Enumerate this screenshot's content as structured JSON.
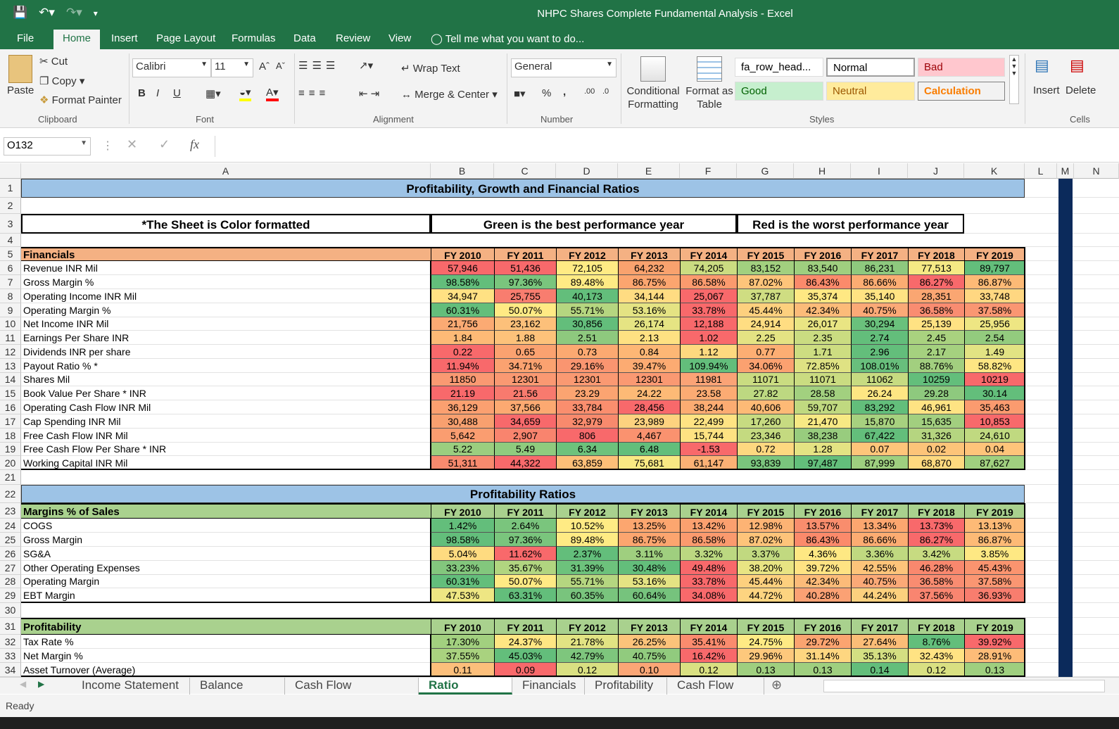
{
  "window": {
    "title": "NHPC Shares Complete Fundamental Analysis - Excel"
  },
  "ribbon_tabs": [
    "File",
    "Home",
    "Insert",
    "Page Layout",
    "Formulas",
    "Data",
    "Review",
    "View"
  ],
  "tell_me": "Tell me what you want to do...",
  "clipboard": {
    "paste": "Paste",
    "cut": "Cut",
    "copy": "Copy",
    "format_painter": "Format Painter",
    "label": "Clipboard"
  },
  "font": {
    "name": "Calibri",
    "size": "11",
    "label": "Font",
    "bold": "B",
    "italic": "I",
    "underline": "U"
  },
  "alignment": {
    "wrap": "Wrap Text",
    "merge": "Merge & Center",
    "label": "Alignment"
  },
  "number": {
    "format": "General",
    "label": "Number",
    "percent": "%",
    "comma": ","
  },
  "styles": {
    "cond": "Conditional Formatting",
    "table": "Format as Table",
    "label": "Styles",
    "cells": [
      {
        "t": "fa_row_head...",
        "bg": "#ffffff",
        "fg": "#000000"
      },
      {
        "t": "Normal",
        "bg": "#ffffff",
        "fg": "#000000"
      },
      {
        "t": "Bad",
        "bg": "#ffc7ce",
        "fg": "#9c0006"
      },
      {
        "t": "Good",
        "bg": "#c6efce",
        "fg": "#006100"
      },
      {
        "t": "Neutral",
        "bg": "#ffeb9c",
        "fg": "#9c5700"
      },
      {
        "t": "Calculation",
        "bg": "#f2f2f2",
        "fg": "#fa7d00"
      }
    ]
  },
  "cells_group": {
    "insert": "Insert",
    "delete": "Delete",
    "label": "Cells"
  },
  "namebox": "O132",
  "fx": "fx",
  "col_headers": [
    "A",
    "B",
    "C",
    "D",
    "E",
    "F",
    "G",
    "H",
    "I",
    "J",
    "K",
    "L",
    "M",
    "N"
  ],
  "title_row": "Profitability, Growth and Financial Ratios",
  "note_a": "*The Sheet is Color formatted",
  "note_green": "Green is the best performance year",
  "note_red": "Red is the worst performance year",
  "years": [
    "FY 2010",
    "FY 2011",
    "FY 2012",
    "FY 2013",
    "FY 2014",
    "FY 2015",
    "FY 2016",
    "FY 2017",
    "FY 2018",
    "FY 2019"
  ],
  "financials": {
    "header": "Financials",
    "rows": [
      {
        "label": "Revenue INR Mil",
        "v": [
          "57,946",
          "51,436",
          "72,105",
          "64,232",
          "74,205",
          "83,152",
          "83,540",
          "86,231",
          "77,513",
          "89,797"
        ],
        "c": [
          "#f8696b",
          "#f8696b",
          "#ffeb84",
          "#f9a26e",
          "#cbdc81",
          "#a2d07f",
          "#9fcf7f",
          "#8ec97e",
          "#f5e984",
          "#63be7b"
        ]
      },
      {
        "label": "Gross Margin %",
        "v": [
          "98.58%",
          "97.36%",
          "89.48%",
          "86.75%",
          "86.58%",
          "87.02%",
          "86.43%",
          "86.66%",
          "86.27%",
          "86.87%"
        ],
        "c": [
          "#63be7b",
          "#7ac57d",
          "#ffeb84",
          "#fca56f",
          "#fb9a6e",
          "#fec47a",
          "#fb8a6b",
          "#fcac72",
          "#f8696b",
          "#fdba76"
        ]
      },
      {
        "label": "Operating Income INR Mil",
        "v": [
          "34,947",
          "25,755",
          "40,173",
          "34,144",
          "25,067",
          "37,787",
          "35,374",
          "35,140",
          "28,351",
          "33,748"
        ],
        "c": [
          "#ffe183",
          "#f87d6f",
          "#63be7b",
          "#ffdc82",
          "#f8696b",
          "#cfdd82",
          "#ffe883",
          "#ffe383",
          "#faa672",
          "#ffd781"
        ]
      },
      {
        "label": "Operating Margin %",
        "v": [
          "60.31%",
          "50.07%",
          "55.71%",
          "53.16%",
          "33.78%",
          "45.44%",
          "42.34%",
          "40.75%",
          "36.58%",
          "37.58%"
        ],
        "c": [
          "#63be7b",
          "#ffea84",
          "#b5d680",
          "#e4e383",
          "#f8696b",
          "#fdd07e",
          "#fcbb79",
          "#fba977",
          "#f98c71",
          "#fa9672"
        ]
      },
      {
        "label": "Net Income INR Mil",
        "v": [
          "21,756",
          "23,162",
          "30,856",
          "26,174",
          "12,188",
          "24,914",
          "26,017",
          "30,294",
          "25,139",
          "25,956"
        ],
        "c": [
          "#fbaa73",
          "#fcc07a",
          "#63be7b",
          "#e5e483",
          "#f8696b",
          "#ffdd82",
          "#e9e583",
          "#6ac17c",
          "#ffe283",
          "#eee683"
        ]
      },
      {
        "label": "Earnings Per Share INR",
        "v": [
          "1.84",
          "1.88",
          "2.51",
          "2.13",
          "1.02",
          "2.25",
          "2.35",
          "2.74",
          "2.45",
          "2.54"
        ],
        "c": [
          "#fdba76",
          "#fdc27a",
          "#8ec97e",
          "#fee182",
          "#f8696b",
          "#e4e383",
          "#cadc81",
          "#63be7b",
          "#a9d27f",
          "#93cb7e"
        ]
      },
      {
        "label": "Dividends INR per share",
        "v": [
          "0.22",
          "0.65",
          "0.73",
          "0.84",
          "1.12",
          "0.77",
          "1.71",
          "2.96",
          "2.17",
          "1.49"
        ],
        "c": [
          "#f8696b",
          "#fba270",
          "#fca971",
          "#fdb775",
          "#fed97f",
          "#fdae73",
          "#cddd81",
          "#63be7b",
          "#a5d17f",
          "#e2e383"
        ]
      },
      {
        "label": "Payout Ratio % *",
        "v": [
          "11.94%",
          "34.71%",
          "29.16%",
          "39.47%",
          "109.94%",
          "34.06%",
          "72.85%",
          "108.01%",
          "88.76%",
          "58.82%"
        ],
        "c": [
          "#f8696b",
          "#fba270",
          "#fa9570",
          "#fcab72",
          "#63be7b",
          "#fba170",
          "#dfe283",
          "#68bf7c",
          "#a2cf7f",
          "#fee683"
        ]
      },
      {
        "label": "Shares Mil",
        "v": [
          "11850",
          "12301",
          "12301",
          "12301",
          "11981",
          "11071",
          "11071",
          "11062",
          "10259",
          "10219"
        ],
        "c": [
          "#fa9972",
          "#fa9972",
          "#fa9972",
          "#fa9972",
          "#fba376",
          "#cadc81",
          "#cadc81",
          "#c7db81",
          "#63be7b",
          "#f8696b"
        ]
      },
      {
        "label": "Book Value Per Share * INR",
        "v": [
          "21.19",
          "21.56",
          "23.29",
          "24.22",
          "23.58",
          "27.82",
          "28.58",
          "26.24",
          "29.28",
          "30.14"
        ],
        "c": [
          "#f8696b",
          "#f87a6e",
          "#fba471",
          "#fdba76",
          "#fcab73",
          "#bdd881",
          "#a2d07f",
          "#fee683",
          "#8ec97e",
          "#63be7b"
        ]
      },
      {
        "label": "Operating Cash Flow INR Mil",
        "v": [
          "36,129",
          "37,566",
          "33,784",
          "28,456",
          "38,244",
          "40,606",
          "59,707",
          "83,292",
          "46,961",
          "35,463"
        ],
        "c": [
          "#fba070",
          "#fca971",
          "#fa8e6e",
          "#f8696b",
          "#fcac72",
          "#fdba76",
          "#c0d980",
          "#63be7b",
          "#fee383",
          "#fb9b6f"
        ]
      },
      {
        "label": "Cap Spending INR Mil",
        "v": [
          "30,488",
          "34,659",
          "32,979",
          "23,989",
          "22,499",
          "17,260",
          "21,470",
          "15,870",
          "15,635",
          "10,853"
        ],
        "c": [
          "#f8a06f",
          "#f8696b",
          "#f88a6d",
          "#fdd27f",
          "#fee383",
          "#c7db81",
          "#f7e984",
          "#a7d17f",
          "#a2cf7f",
          "#f8696b"
        ]
      },
      {
        "label": "Free Cash Flow INR Mil",
        "v": [
          "5,642",
          "2,907",
          "806",
          "4,467",
          "15,744",
          "23,346",
          "38,238",
          "67,422",
          "31,326",
          "24,610"
        ],
        "c": [
          "#fa9d70",
          "#f9846e",
          "#f8696b",
          "#fa926f",
          "#fee282",
          "#c4da80",
          "#98cc7e",
          "#63be7b",
          "#b5d580",
          "#c0d980"
        ]
      },
      {
        "label": "Free Cash Flow Per Share * INR",
        "v": [
          "5.22",
          "5.49",
          "6.34",
          "6.48",
          "-1.53",
          "0.72",
          "1.28",
          "0.07",
          "0.02",
          "0.04"
        ],
        "c": [
          "#9bce7f",
          "#8fcb7e",
          "#6dc27c",
          "#63be7b",
          "#f8696b",
          "#fed880",
          "#e4e383",
          "#fec57a",
          "#fdc479",
          "#fec47a"
        ]
      },
      {
        "label": "Working Capital INR Mil",
        "v": [
          "51,311",
          "44,322",
          "63,859",
          "75,681",
          "61,147",
          "93,839",
          "97,487",
          "87,999",
          "68,870",
          "87,627"
        ],
        "c": [
          "#f88a6e",
          "#f8696b",
          "#fdbf78",
          "#f9e983",
          "#fcb175",
          "#7ac57d",
          "#63be7b",
          "#9ecf7f",
          "#fed97f",
          "#a0d07f"
        ]
      }
    ]
  },
  "profitability_title": "Profitability Ratios",
  "margins": {
    "header": "Margins % of Sales",
    "rows": [
      {
        "label": "COGS",
        "v": [
          "1.42%",
          "2.64%",
          "10.52%",
          "13.25%",
          "13.42%",
          "12.98%",
          "13.57%",
          "13.34%",
          "13.73%",
          "13.13%"
        ],
        "c": [
          "#63be7b",
          "#7ac57d",
          "#ffeb84",
          "#fca66f",
          "#fba06f",
          "#fdb374",
          "#f98d6d",
          "#fca66f",
          "#f8696b",
          "#fdba76"
        ]
      },
      {
        "label": "Gross Margin",
        "v": [
          "98.58%",
          "97.36%",
          "89.48%",
          "86.75%",
          "86.58%",
          "87.02%",
          "86.43%",
          "86.66%",
          "86.27%",
          "86.87%"
        ],
        "c": [
          "#63be7b",
          "#7ac57d",
          "#ffeb84",
          "#fca56f",
          "#fb9a6e",
          "#fec47a",
          "#fb8a6b",
          "#fcac72",
          "#f8696b",
          "#fdba76"
        ]
      },
      {
        "label": "SG&A",
        "v": [
          "5.04%",
          "11.62%",
          "2.37%",
          "3.11%",
          "3.32%",
          "3.37%",
          "4.36%",
          "3.36%",
          "3.42%",
          "3.85%"
        ],
        "c": [
          "#fedb80",
          "#f8696b",
          "#63be7b",
          "#9fcf7f",
          "#bcd881",
          "#c1d980",
          "#fee883",
          "#c0d980",
          "#c7db81",
          "#fee883"
        ]
      },
      {
        "label": "Other Operating Expenses",
        "v": [
          "33.23%",
          "35.67%",
          "31.39%",
          "30.48%",
          "49.48%",
          "38.20%",
          "39.72%",
          "42.55%",
          "46.28%",
          "45.43%"
        ],
        "c": [
          "#83c77d",
          "#b1d580",
          "#6dc27c",
          "#63be7b",
          "#f8696b",
          "#e8e483",
          "#fee383",
          "#fdc47a",
          "#f9886e",
          "#fa946f"
        ]
      },
      {
        "label": "Operating Margin",
        "v": [
          "60.31%",
          "50.07%",
          "55.71%",
          "53.16%",
          "33.78%",
          "45.44%",
          "42.34%",
          "40.75%",
          "36.58%",
          "37.58%"
        ],
        "c": [
          "#63be7b",
          "#ffea84",
          "#b5d680",
          "#e4e383",
          "#f8696b",
          "#fdd07e",
          "#fcbb79",
          "#fba977",
          "#f98c71",
          "#fa9672"
        ]
      },
      {
        "label": "EBT Margin",
        "v": [
          "47.53%",
          "63.31%",
          "60.35%",
          "60.64%",
          "34.08%",
          "44.72%",
          "40.28%",
          "44.24%",
          "37.56%",
          "36.93%"
        ],
        "c": [
          "#eee683",
          "#63be7b",
          "#79c47d",
          "#76c37d",
          "#f8696b",
          "#fdd480",
          "#fba174",
          "#fcd07e",
          "#f98570",
          "#f87d6e"
        ]
      }
    ]
  },
  "profitability": {
    "header": "Profitability",
    "rows": [
      {
        "label": "Tax Rate %",
        "v": [
          "17.30%",
          "24.37%",
          "21.78%",
          "26.25%",
          "35.41%",
          "24.75%",
          "29.72%",
          "27.64%",
          "8.76%",
          "39.92%"
        ],
        "c": [
          "#a2d07f",
          "#fee683",
          "#e2e383",
          "#fcc37a",
          "#fa8b6e",
          "#feea84",
          "#fba470",
          "#fbbd77",
          "#63be7b",
          "#f8696b"
        ]
      },
      {
        "label": "Net Margin %",
        "v": [
          "37.55%",
          "45.03%",
          "42.79%",
          "40.75%",
          "16.42%",
          "29.96%",
          "31.14%",
          "35.13%",
          "32.43%",
          "28.91%"
        ],
        "c": [
          "#a9d27f",
          "#63be7b",
          "#7ec67d",
          "#91cb7e",
          "#f8696b",
          "#fdc87c",
          "#fed680",
          "#d4df82",
          "#ffe383",
          "#fdbc78"
        ]
      },
      {
        "label": "Asset Turnover (Average)",
        "v": [
          "0.11",
          "0.09",
          "0.12",
          "0.10",
          "0.12",
          "0.13",
          "0.13",
          "0.14",
          "0.12",
          "0.13"
        ],
        "c": [
          "#fcbf7b",
          "#f8696b",
          "#d9e082",
          "#fba676",
          "#d9e082",
          "#9fcf7f",
          "#9fcf7f",
          "#63be7b",
          "#d9e082",
          "#9fcf7f"
        ]
      }
    ]
  },
  "row_numbers": [
    "1",
    "2",
    "3",
    "4",
    "5",
    "6",
    "7",
    "8",
    "9",
    "10",
    "11",
    "12",
    "13",
    "14",
    "15",
    "16",
    "17",
    "18",
    "19",
    "20",
    "21",
    "22",
    "23",
    "24",
    "25",
    "26",
    "27",
    "28",
    "29",
    "30",
    "31",
    "32",
    "33",
    "34"
  ],
  "sheet_tabs": [
    "Income Statement",
    "Balance Sheet",
    "Cash Flow Statement",
    "Ratio Analysis",
    "Financials",
    "Profitability",
    "Cash Flow Rat ..."
  ],
  "active_sheet": "Ratio Analysis",
  "status": "Ready"
}
